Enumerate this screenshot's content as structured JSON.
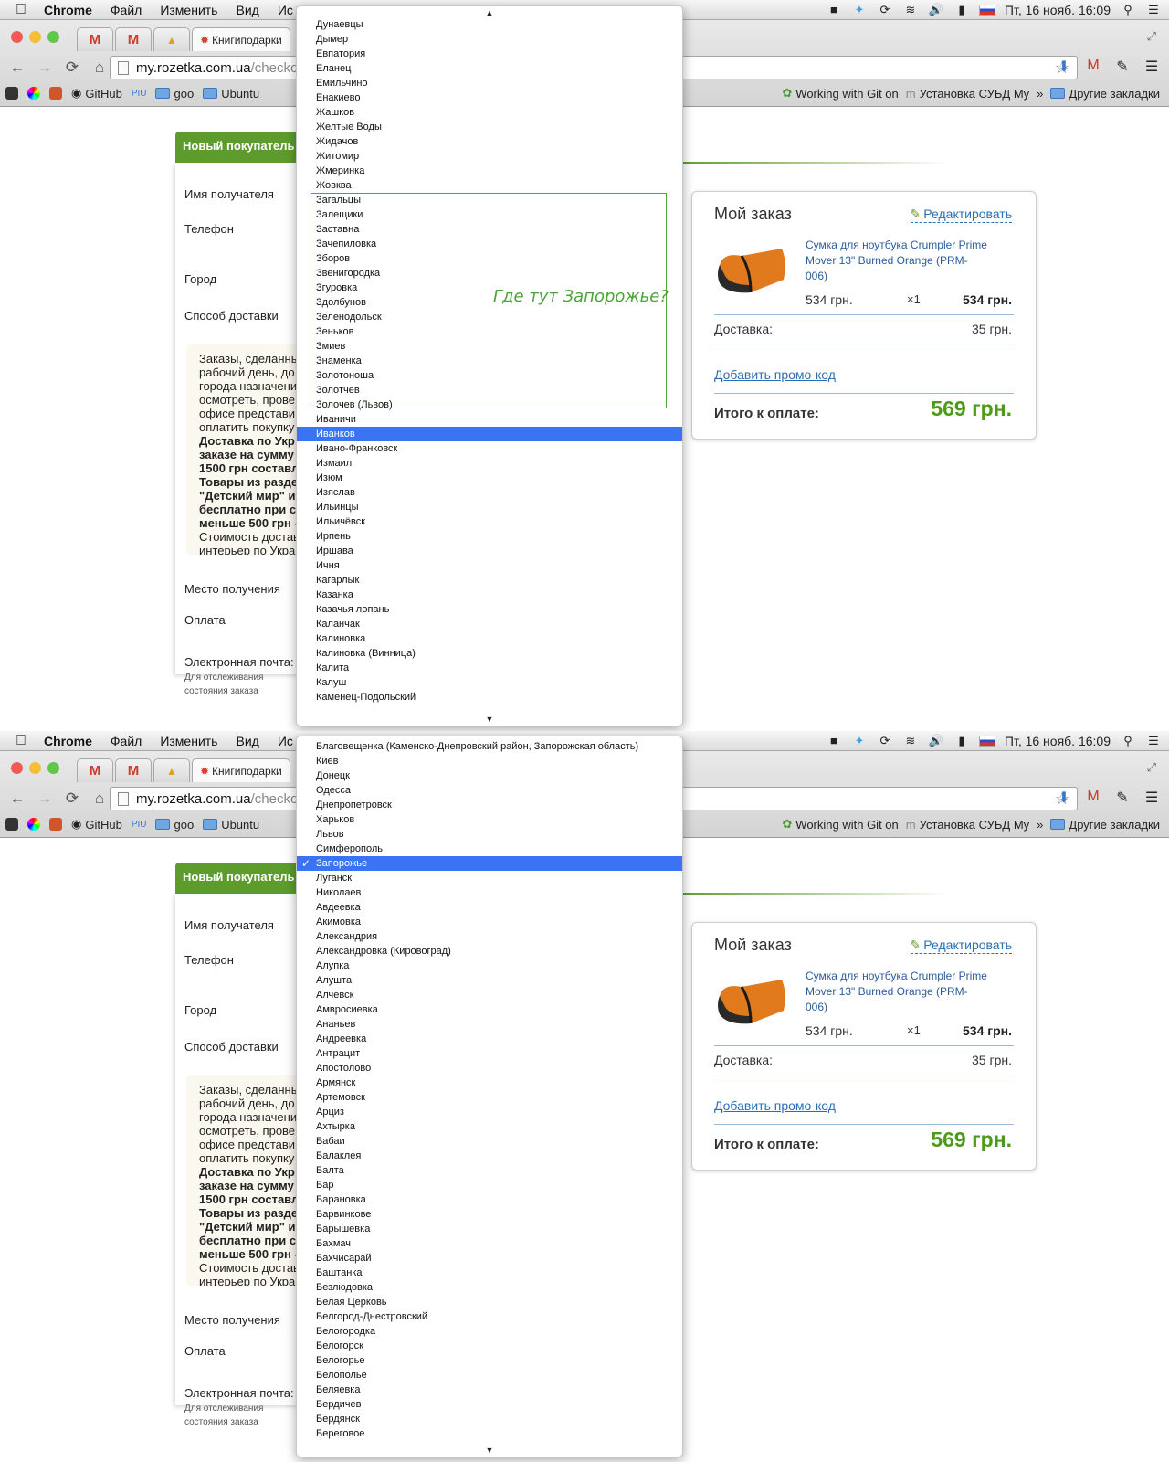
{
  "menubar": {
    "app": "Chrome",
    "items": [
      "Файл",
      "Изменить",
      "Вид",
      "Ис"
    ],
    "datetime": "Пт, 16 нояб.  16:09"
  },
  "browser": {
    "tabs": [
      {
        "label": "",
        "icon": "gmail-icon"
      },
      {
        "label": "",
        "icon": "gmail-icon"
      },
      {
        "label": "",
        "icon": "app-icon"
      },
      {
        "label": "Книгиподарки",
        "icon": "site-icon"
      }
    ],
    "address": {
      "host": "my.rozetka.com.ua",
      "path": "/checkou"
    },
    "bookmarks": [
      "GitHub",
      "PIU",
      "goo",
      "Ubuntu"
    ],
    "bookmarks_right": [
      "Working with Git on",
      "Установка СУБД My",
      "Другие закладки"
    ]
  },
  "checkout": {
    "new_buyer_label": "Новый покупатель",
    "fields": {
      "recipient": "Имя получателя",
      "phone": "Телефон",
      "city": "Город",
      "delivery": "Способ доставки",
      "pickup": "Место получения",
      "payment": "Оплата",
      "email": "Электронная почта:",
      "email_hint_1": "Для отслеживания",
      "email_hint_2": "состояния заказа"
    },
    "info_lines": [
      {
        "text": "Заказы, сделанны",
        "bold": false
      },
      {
        "text": "рабочий день, до",
        "bold": false
      },
      {
        "text": "города назначени",
        "bold": false
      },
      {
        "text": "осмотреть, прове",
        "bold": false
      },
      {
        "text": "офисе представи",
        "bold": false
      },
      {
        "text": "оплатить покупку",
        "bold": false
      },
      {
        "text": "Доставка по Укр",
        "bold": true
      },
      {
        "text": "заказе на сумму",
        "bold": true
      },
      {
        "text": "1500 грн составл",
        "bold": true
      },
      {
        "text": "Товары из разде",
        "bold": true
      },
      {
        "text": "\"Детский мир\" и",
        "bold": true
      },
      {
        "text": "бесплатно при с",
        "bold": true
      },
      {
        "text": "меньше 500 грн -",
        "bold": true
      },
      {
        "text": "Стоимость достав",
        "bold": false
      },
      {
        "text": "интерьер по Укра",
        "bold": false
      }
    ]
  },
  "order": {
    "title": "Мой заказ",
    "edit": "Редактировать",
    "product_line1": "Сумка для ноутбука Crumpler Prime",
    "product_line2": "Mover 13\" Burned Orange (PRM-",
    "product_line3": "006)",
    "price": "534 грн.",
    "qty": "×1",
    "sum": "534 грн.",
    "delivery_label": "Доставка:",
    "delivery_value": "35 грн.",
    "promo": "Добавить промо-код",
    "total_label": "Итого к оплате:",
    "total_value": "569 грн."
  },
  "dropdown1": {
    "items": [
      "Дунаевцы",
      "Дымер",
      "Евпатория",
      "Еланец",
      "Емильчино",
      "Енакиево",
      "Жашков",
      "Желтые Воды",
      "Жидачов",
      "Житомир",
      "Жмеринка",
      "Жовква",
      "Загальцы",
      "Залещики",
      "Заставна",
      "Зачепиловка",
      "Зборов",
      "Звенигородка",
      "Згуровка",
      "Здолбунов",
      "Зеленодольск",
      "Зеньков",
      "Змиев",
      "Знаменка",
      "Золотоноша",
      "Золотчев",
      "Золочев (Львов)",
      "Иваничи",
      "Иванков",
      "Ивано-Франковск",
      "Измаил",
      "Изюм",
      "Изяслав",
      "Ильинцы",
      "Ильичёвск",
      "Ирпень",
      "Иршава",
      "Ичня",
      "Кагарлык",
      "Казанка",
      "Казачья лопань",
      "Каланчак",
      "Калиновка",
      "Калиновка (Винница)",
      "Калита",
      "Калуш",
      "Каменец-Подольский"
    ],
    "highlighted_index": 28
  },
  "annotation": "Где тут Запорожье?",
  "dropdown2": {
    "items": [
      "Благовещенка (Каменско-Днепровский район, Запорожская область)",
      "Киев",
      "Донецк",
      "Одесса",
      "Днепропетровск",
      "Харьков",
      "Львов",
      "Симферополь",
      "Запорожье",
      "Луганск",
      "Николаев",
      "Авдеевка",
      "Акимовка",
      "Александрия",
      "Александровка (Кировоград)",
      "Алупка",
      "Алушта",
      "Алчевск",
      "Амвросиевка",
      "Ананьев",
      "Андреевка",
      "Антрацит",
      "Апостолово",
      "Армянск",
      "Артемовск",
      "Арциз",
      "Ахтырка",
      "Бабаи",
      "Балаклея",
      "Балта",
      "Бар",
      "Барановка",
      "Барвинкове",
      "Барышевка",
      "Бахмач",
      "Бахчисарай",
      "Баштанка",
      "Безлюдовка",
      "Белая Церковь",
      "Белгород-Днестровский",
      "Белогородка",
      "Белогорск",
      "Белогорье",
      "Белополье",
      "Беляевка",
      "Бердичев",
      "Бердянск",
      "Береговое"
    ],
    "highlighted_index": 8
  },
  "colors": {
    "brand_green": "#5d9c2c",
    "total_green": "#4c9a1a",
    "link_blue": "#2a6fb6",
    "highlight_blue": "#3b74f2"
  }
}
